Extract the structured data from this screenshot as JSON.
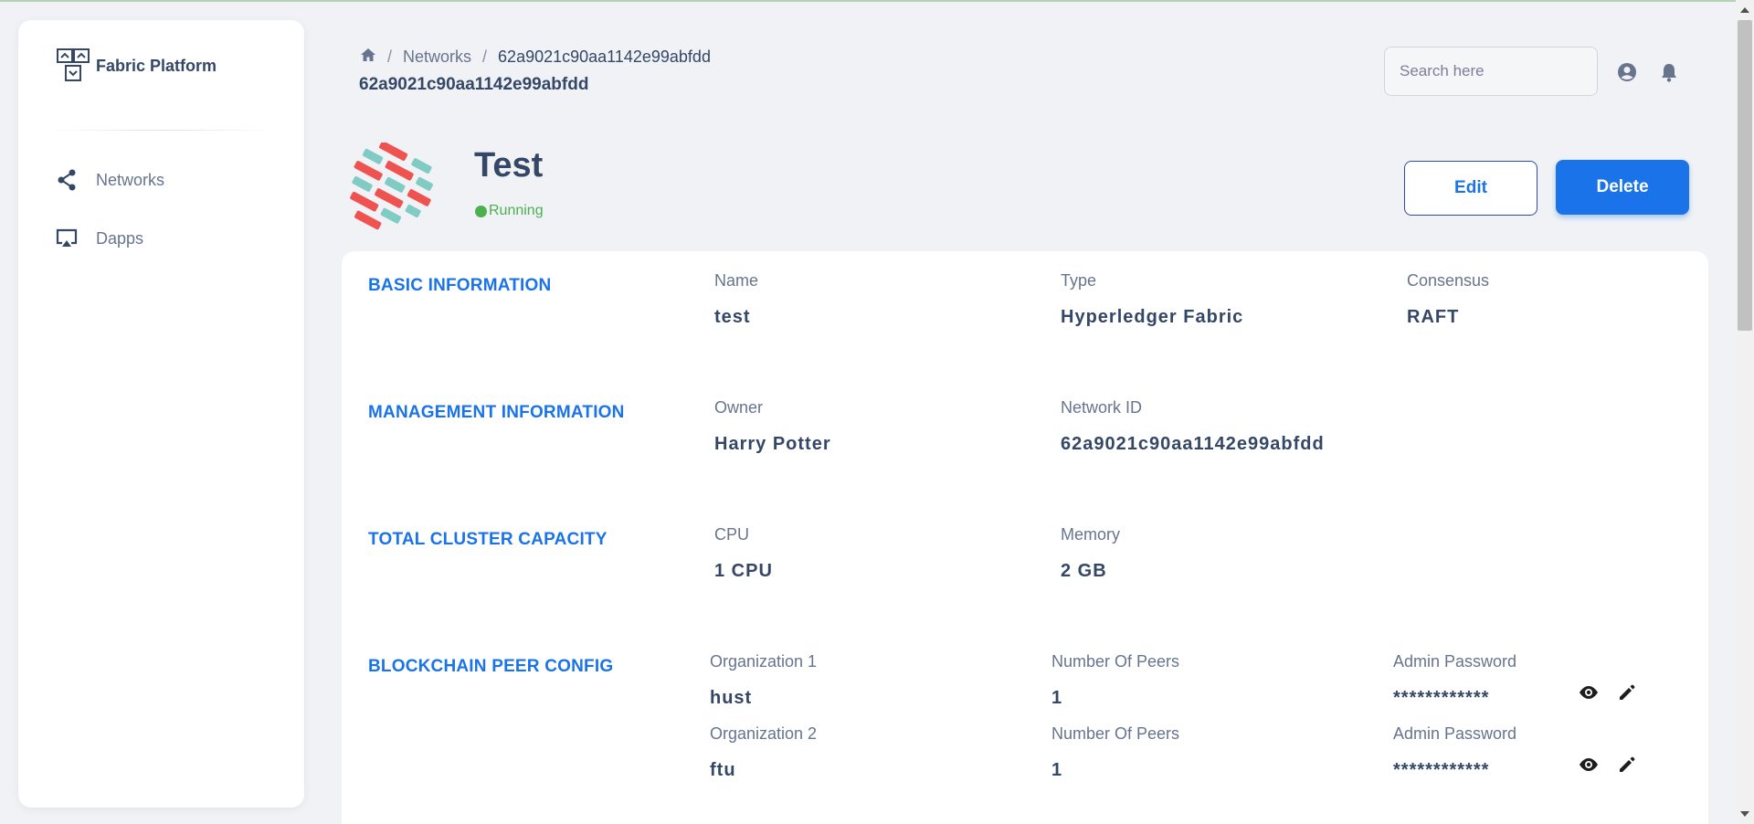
{
  "app": {
    "brand": "Fabric Platform"
  },
  "sidebar": {
    "items": [
      {
        "label": "Networks",
        "icon": "share-icon"
      },
      {
        "label": "Dapps",
        "icon": "airplay-icon"
      }
    ]
  },
  "header": {
    "breadcrumb": {
      "home_icon": "home-icon",
      "separator": "/",
      "parent": "Networks",
      "current": "62a9021c90aa1142e99abfdd"
    },
    "page_subtitle": "62a9021c90aa1142e99abfdd",
    "search": {
      "placeholder": "Search here",
      "value": ""
    },
    "icons": [
      "account-circle-icon",
      "bell-icon"
    ]
  },
  "network": {
    "title": "Test",
    "status": "Running",
    "status_color": "#4caf50",
    "edit_label": "Edit",
    "delete_label": "Delete"
  },
  "sections": {
    "basic": {
      "title": "BASIC INFORMATION",
      "name_label": "Name",
      "name_value": "test",
      "type_label": "Type",
      "type_value": "Hyperledger Fabric",
      "consensus_label": "Consensus",
      "consensus_value": "RAFT"
    },
    "management": {
      "title": "MANAGEMENT INFORMATION",
      "owner_label": "Owner",
      "owner_value": "Harry Potter",
      "network_id_label": "Network ID",
      "network_id_value": "62a9021c90aa1142e99abfdd"
    },
    "capacity": {
      "title": "TOTAL CLUSTER CAPACITY",
      "cpu_label": "CPU",
      "cpu_value": "1 CPU",
      "memory_label": "Memory",
      "memory_value": "2 GB"
    },
    "peer_config": {
      "title": "BLOCKCHAIN PEER CONFIG",
      "orgs": [
        {
          "org_label": "Organization 1",
          "org_value": "hust",
          "peers_label": "Number Of Peers",
          "peers_value": "1",
          "password_label": "Admin Password",
          "password_value": "************"
        },
        {
          "org_label": "Organization 2",
          "org_value": "ftu",
          "peers_label": "Number Of Peers",
          "peers_value": "1",
          "password_label": "Admin Password",
          "password_value": "************"
        }
      ]
    }
  },
  "colors": {
    "accent": "#1a73e8",
    "text": "#344767",
    "muted": "#67748e",
    "background": "#f0f2f5"
  }
}
